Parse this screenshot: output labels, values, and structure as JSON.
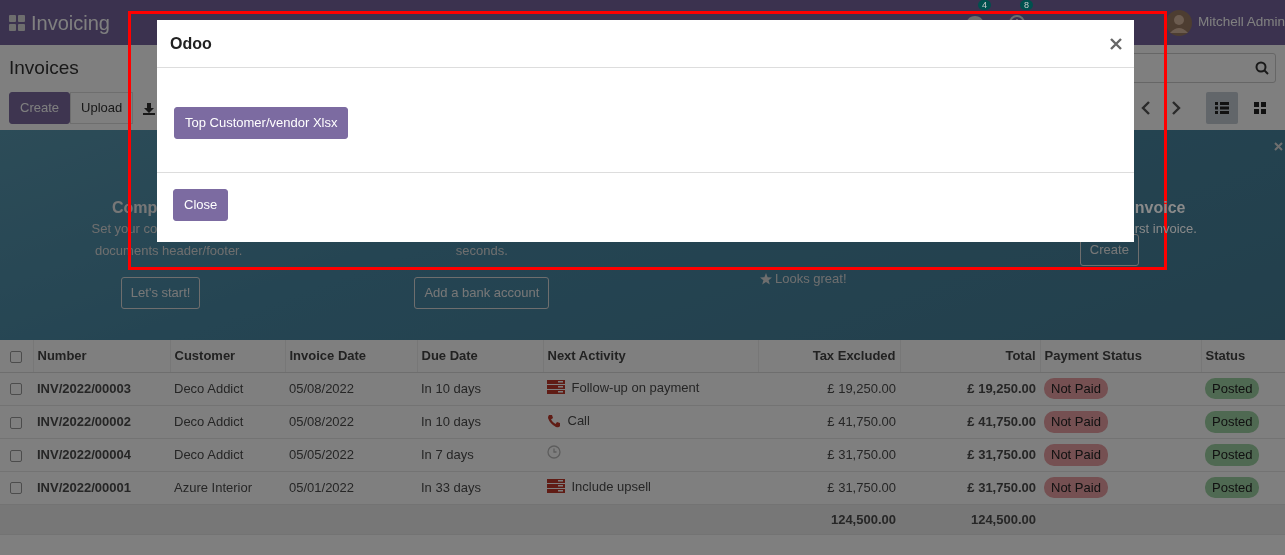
{
  "navbar": {
    "app_name": "Invoicing",
    "messages_count": "4",
    "activities_count": "8",
    "user": "Mitchell Admin"
  },
  "control_panel": {
    "title": "Invoices",
    "buttons": [
      "Create",
      "Upload"
    ],
    "views": [
      {
        "kind": "list",
        "selected": true
      },
      {
        "kind": "kanban",
        "selected": false
      }
    ]
  },
  "banner": {
    "steps": [
      {
        "title": "Comp",
        "lines": [
          "Set your co",
          "documents header/footer."
        ],
        "button": "Let's start!"
      },
      {
        "lines": [
          "seconds."
        ],
        "button": "Add a bank account"
      },
      {
        "done": "Looks great!"
      },
      {
        "title": "nvoice",
        "lines": [
          "rst invoice."
        ],
        "button": "Create"
      }
    ]
  },
  "table": {
    "all_checked": false,
    "columns": [
      "Number",
      "Customer",
      "Invoice Date",
      "Due Date",
      "Next Activity",
      "Tax Excluded",
      "Total",
      "Payment Status",
      "Status"
    ],
    "rows": [
      {
        "number": "INV/2022/00003",
        "customer": "Deco Addict",
        "invoice_date": "05/08/2022",
        "due_date": "In 10 days",
        "activity": {
          "kind": "todo",
          "summary": "Follow-up on payment"
        },
        "tax_excluded": "£ 19,250.00",
        "total": "£ 19,250.00",
        "payment_status": "Not Paid",
        "status": "Posted",
        "checked": false
      },
      {
        "number": "INV/2022/00002",
        "customer": "Deco Addict",
        "invoice_date": "05/08/2022",
        "due_date": "In 10 days",
        "activity": {
          "kind": "call",
          "summary": "Call"
        },
        "tax_excluded": "£ 41,750.00",
        "total": "£ 41,750.00",
        "payment_status": "Not Paid",
        "status": "Posted",
        "checked": false
      },
      {
        "number": "INV/2022/00004",
        "customer": "Deco Addict",
        "invoice_date": "05/05/2022",
        "due_date": "In 7 days",
        "activity": {
          "kind": "none"
        },
        "tax_excluded": "£ 31,750.00",
        "total": "£ 31,750.00",
        "payment_status": "Not Paid",
        "status": "Posted",
        "checked": false
      },
      {
        "number": "INV/2022/00001",
        "customer": "Azure Interior",
        "invoice_date": "05/01/2022",
        "due_date": "In 33 days",
        "activity": {
          "kind": "todo",
          "summary": "Include upsell"
        },
        "tax_excluded": "£ 31,750.00",
        "total": "£ 31,750.00",
        "payment_status": "Not Paid",
        "status": "Posted",
        "checked": false
      }
    ],
    "totals": {
      "tax_excluded": "124,500.00",
      "total": "124,500.00"
    }
  },
  "dialog": {
    "title": "Odoo",
    "action_button": "Top Customer/vendor Xlsx",
    "close_button": "Close"
  }
}
